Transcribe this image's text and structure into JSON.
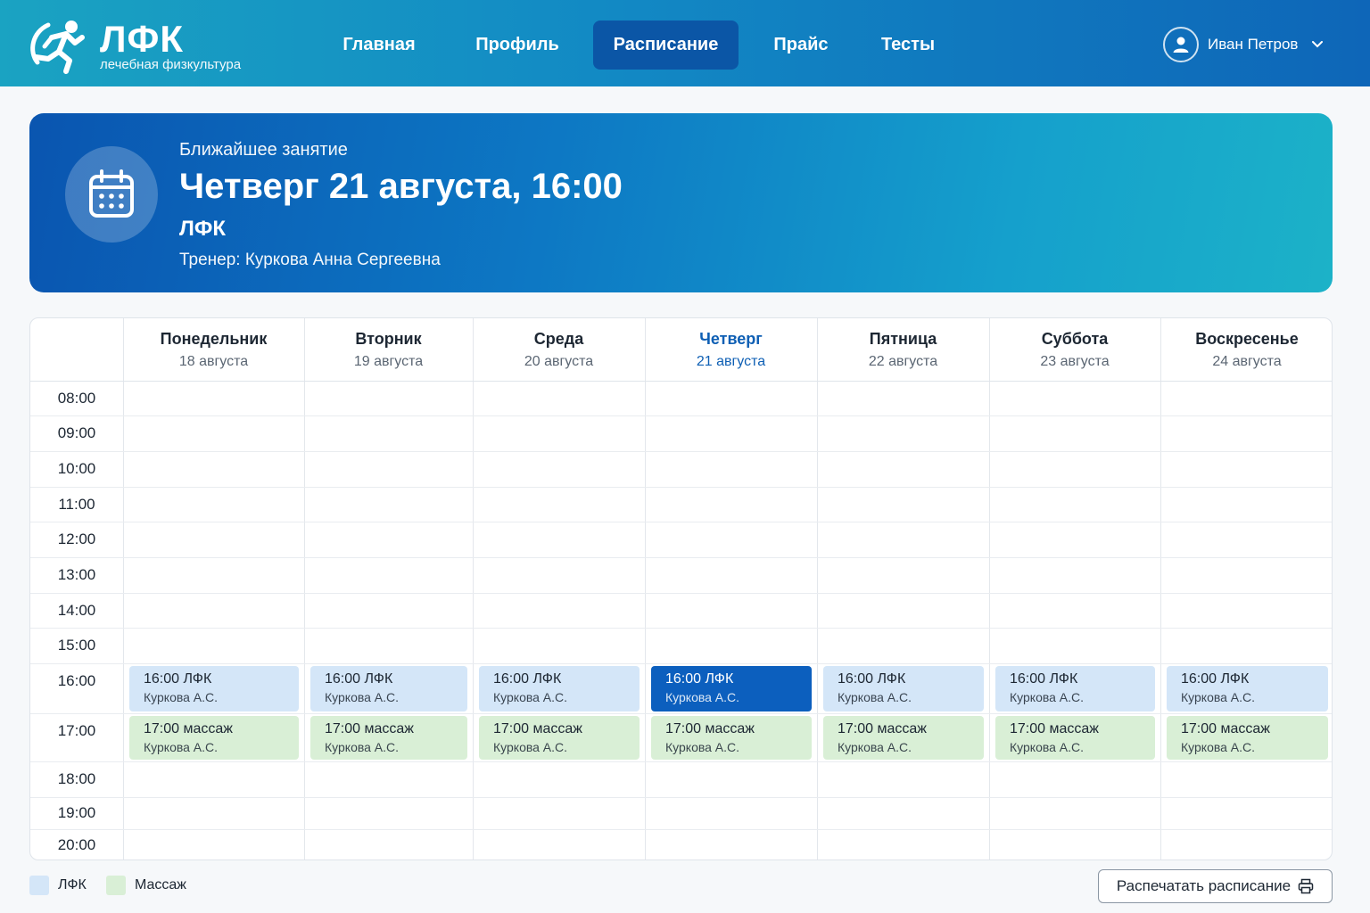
{
  "app": {
    "logo_title": "ЛФК",
    "logo_subtitle": "лечебная физкультура"
  },
  "nav": {
    "items": [
      {
        "label": "Главная",
        "active": false
      },
      {
        "label": "Профиль",
        "active": false
      },
      {
        "label": "Расписание",
        "active": true
      },
      {
        "label": "Прайс",
        "active": false
      },
      {
        "label": "Тесты",
        "active": false
      }
    ]
  },
  "user": {
    "name": "Иван Петров",
    "icon": "user-icon"
  },
  "next_session": {
    "label": "Ближайшее занятие",
    "datetime": "Четверг 21 августа, 16:00",
    "type": "ЛФК",
    "trainer": "Тренер: Куркова Анна Сергеевна",
    "icon": "calendar-icon"
  },
  "schedule": {
    "days": [
      {
        "name": "Понедельник",
        "date": "18 августа"
      },
      {
        "name": "Вторник",
        "date": "19 августа"
      },
      {
        "name": "Среда",
        "date": "20 августа"
      },
      {
        "name": "Четверг",
        "date": "21 августа",
        "today": true
      },
      {
        "name": "Пятница",
        "date": "22 августа"
      },
      {
        "name": "Суббота",
        "date": "23 августа"
      },
      {
        "name": "Воскресенье",
        "date": "24 августа"
      }
    ],
    "times": [
      "08:00",
      "09:00",
      "10:00",
      "11:00",
      "12:00",
      "13:00",
      "14:00",
      "15:00",
      "16:00",
      "17:00",
      "18:00",
      "19:00",
      "20:00"
    ],
    "events": [
      {
        "title": "16:00 ЛФК",
        "trainer": "Куркова А.С.",
        "kind": "lfk"
      },
      {
        "title": "17:00 массаж",
        "trainer": "Куркова А.С.",
        "kind": "massage"
      }
    ],
    "current_day": 3
  },
  "legend": [
    {
      "label": "ЛФК",
      "color": "#d4e6f8"
    },
    {
      "label": "Массаж",
      "color": "#d9efd6"
    }
  ],
  "print": {
    "label": "Распечатать расписание",
    "icon": "printer-icon"
  },
  "colors": {
    "accent": "#0c5fbe",
    "lfk": "#d4e6f8",
    "massage": "#d9efd6",
    "header_start": "#1aa3c2",
    "header_end": "#0e66b8"
  }
}
